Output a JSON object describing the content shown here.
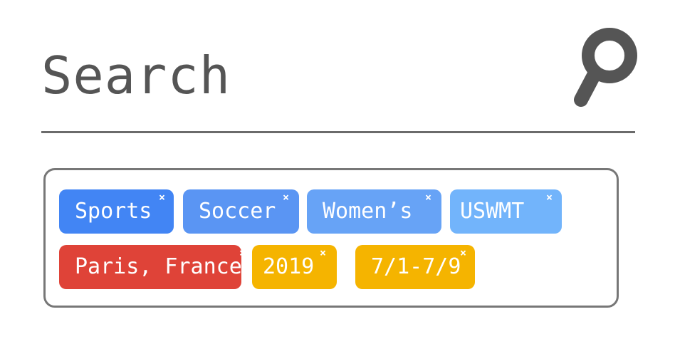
{
  "search": {
    "title": "Search"
  },
  "colors": {
    "title": "#555555",
    "underline": "#6b6b6b",
    "icon": "#555555",
    "box_border": "#777777",
    "close_glyph": "#ffffff"
  },
  "tags": [
    {
      "label": "Sports",
      "color": "#4285f4",
      "close": "×"
    },
    {
      "label": "Soccer",
      "color": "#5a95f3",
      "close": "×"
    },
    {
      "label": "Women’s",
      "color": "#67a3f6",
      "close": "×"
    },
    {
      "label": "USWMT",
      "color": "#72b4fb",
      "close": "×"
    },
    {
      "label": "Paris, France",
      "color": "#df4338",
      "close": "×"
    },
    {
      "label": "2019",
      "color": "#f5b400",
      "close": "×"
    },
    {
      "label": "7/1-7/9",
      "color": "#f5b400",
      "close": "×"
    }
  ]
}
